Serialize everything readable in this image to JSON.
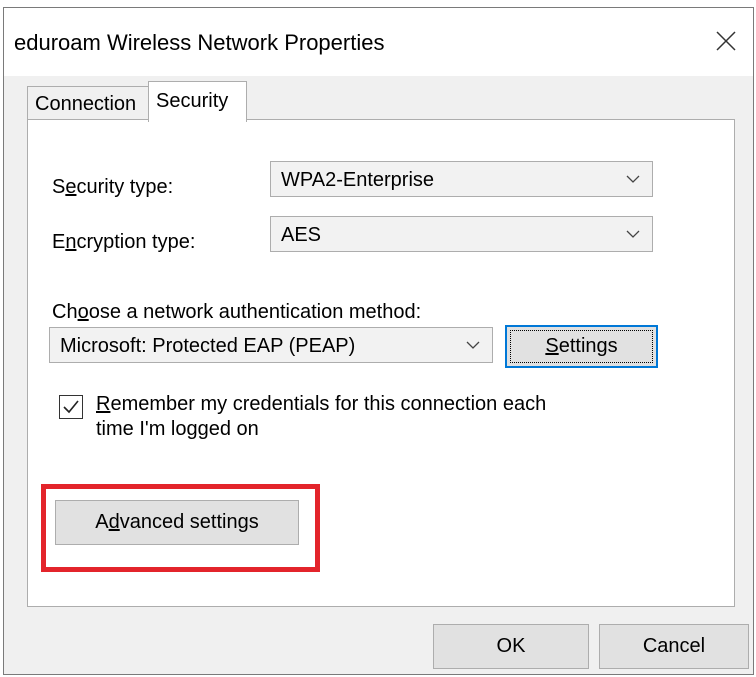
{
  "dialog": {
    "title": "eduroam Wireless Network Properties"
  },
  "tabs": [
    {
      "label": "Connection",
      "active": false
    },
    {
      "label": "Security",
      "active": true
    }
  ],
  "security": {
    "security_type": {
      "label_pre": "S",
      "label_key": "e",
      "label_post": "curity type:",
      "value": "WPA2-Enterprise"
    },
    "encryption_type": {
      "label_pre": "E",
      "label_key": "n",
      "label_post": "cryption type:",
      "value": "AES"
    },
    "auth_method": {
      "label_pre": "Ch",
      "label_key": "o",
      "label_post": "ose a network authentication method:",
      "value": "Microsoft: Protected EAP (PEAP)"
    },
    "settings_button": {
      "key": "S",
      "rest": "ettings"
    },
    "remember": {
      "checked": true,
      "key": "R",
      "rest_line1": "emember my credentials for this connection each",
      "line2": "time I'm logged on"
    },
    "advanced_button": {
      "pre": "A",
      "key": "d",
      "rest": "vanced settings"
    }
  },
  "footer": {
    "ok_label": "OK",
    "cancel_label": "Cancel"
  },
  "colors": {
    "highlight": "#e3242b",
    "focus": "#0078d7"
  }
}
